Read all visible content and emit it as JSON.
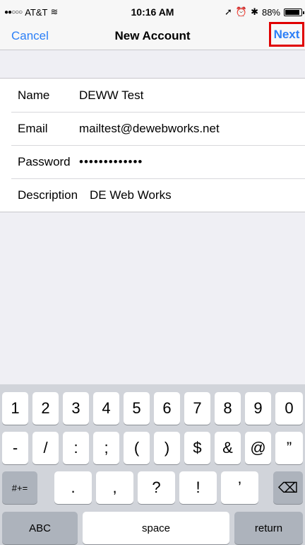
{
  "status": {
    "carrier": "AT&T",
    "time": "10:16 AM",
    "battery": "88%"
  },
  "nav": {
    "cancel": "Cancel",
    "title": "New Account",
    "next": "Next"
  },
  "form": {
    "rows": [
      {
        "label": "Name",
        "value": "DEWW Test"
      },
      {
        "label": "Email",
        "value": "mailtest@dewebworks.net"
      },
      {
        "label": "Password",
        "value": "•••••••••••••"
      },
      {
        "label": "Description",
        "value": "DE Web Works"
      }
    ]
  },
  "keyboard": {
    "row1": [
      "1",
      "2",
      "3",
      "4",
      "5",
      "6",
      "7",
      "8",
      "9",
      "0"
    ],
    "row2": [
      "-",
      "/",
      ":",
      ";",
      "(",
      ")",
      "$",
      "&",
      "@",
      "”"
    ],
    "row3": [
      ".",
      ",",
      "?",
      "!",
      "’"
    ],
    "symbols_key": "#+=",
    "delete_icon": "⌫",
    "abc_key": "ABC",
    "space_key": "space",
    "return_key": "return"
  }
}
